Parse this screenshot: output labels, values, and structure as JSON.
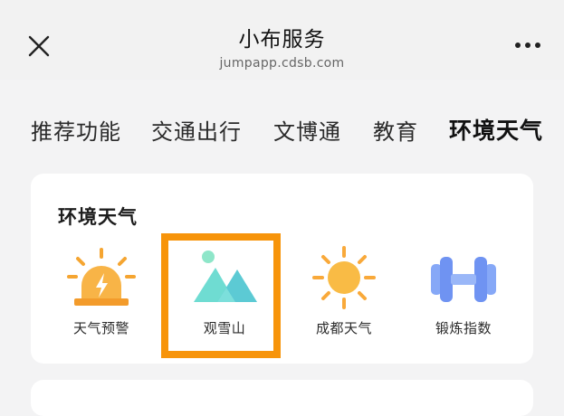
{
  "header": {
    "title": "小布服务",
    "subtitle": "jumpapp.cdsb.com",
    "close_icon": "close-icon",
    "more_icon": "more-icon"
  },
  "tabs": [
    {
      "label": "推荐功能"
    },
    {
      "label": "交通出行"
    },
    {
      "label": "文博通"
    },
    {
      "label": "教育"
    },
    {
      "label": "环境天气",
      "active": true
    }
  ],
  "section": {
    "title": "环境天气",
    "items": [
      {
        "label": "天气预警",
        "icon": "weather-alert-icon"
      },
      {
        "label": "观雪山",
        "icon": "snow-mountain-icon",
        "highlighted": true
      },
      {
        "label": "成都天气",
        "icon": "sun-icon"
      },
      {
        "label": "锻炼指数",
        "icon": "dumbbell-icon"
      }
    ]
  },
  "colors": {
    "highlight": "#f7940a",
    "alert_orange": "#f5a531",
    "mountain_teal": "#5fd7d0",
    "sun_orange": "#f8b83a",
    "dumbbell_blue": "#7b9ff5"
  }
}
